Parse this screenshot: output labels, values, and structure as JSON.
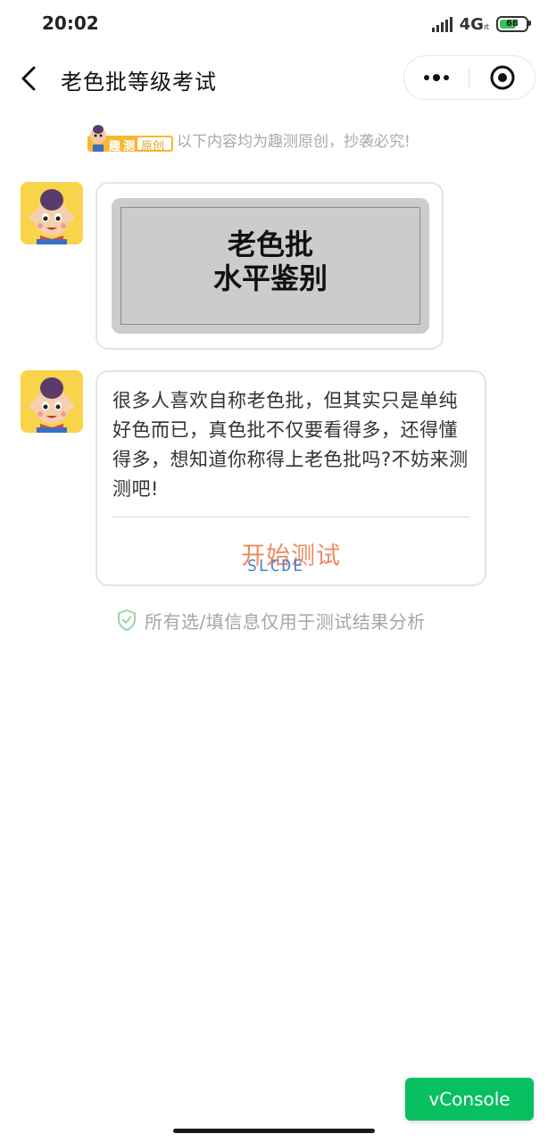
{
  "status_bar": {
    "time": "20:02",
    "network": "4G",
    "network_sub": "ıt",
    "battery": "68",
    "battery_level": 0.68
  },
  "nav": {
    "title": "老色批等级考试",
    "back_icon": "chevron-left-icon",
    "more_icon": "more-dots-icon",
    "close_icon": "target-close-icon"
  },
  "notice": {
    "logo_label_1": "趣",
    "logo_label_2": "测",
    "logo_label_3": "原创",
    "text": "以下内容均为趣测原创，抄袭必究!"
  },
  "cover": {
    "line1": "老色批",
    "line2": "水平鉴别"
  },
  "intro": {
    "text": "很多人喜欢自称老色批，但其实只是单纯好色而已，真色批不仅要看得多，还得懂得多，想知道你称得上老色批吗?不妨来测测吧!",
    "button": "开始测试",
    "watermark": "SLCDE"
  },
  "privacy": {
    "text": "所有选/填信息仅用于测试结果分析"
  },
  "vconsole": {
    "label": "vConsole"
  },
  "colors": {
    "accent_orange": "#ef8a62",
    "wechat_green": "#07c160",
    "avatar_yellow": "#f9d34a"
  }
}
